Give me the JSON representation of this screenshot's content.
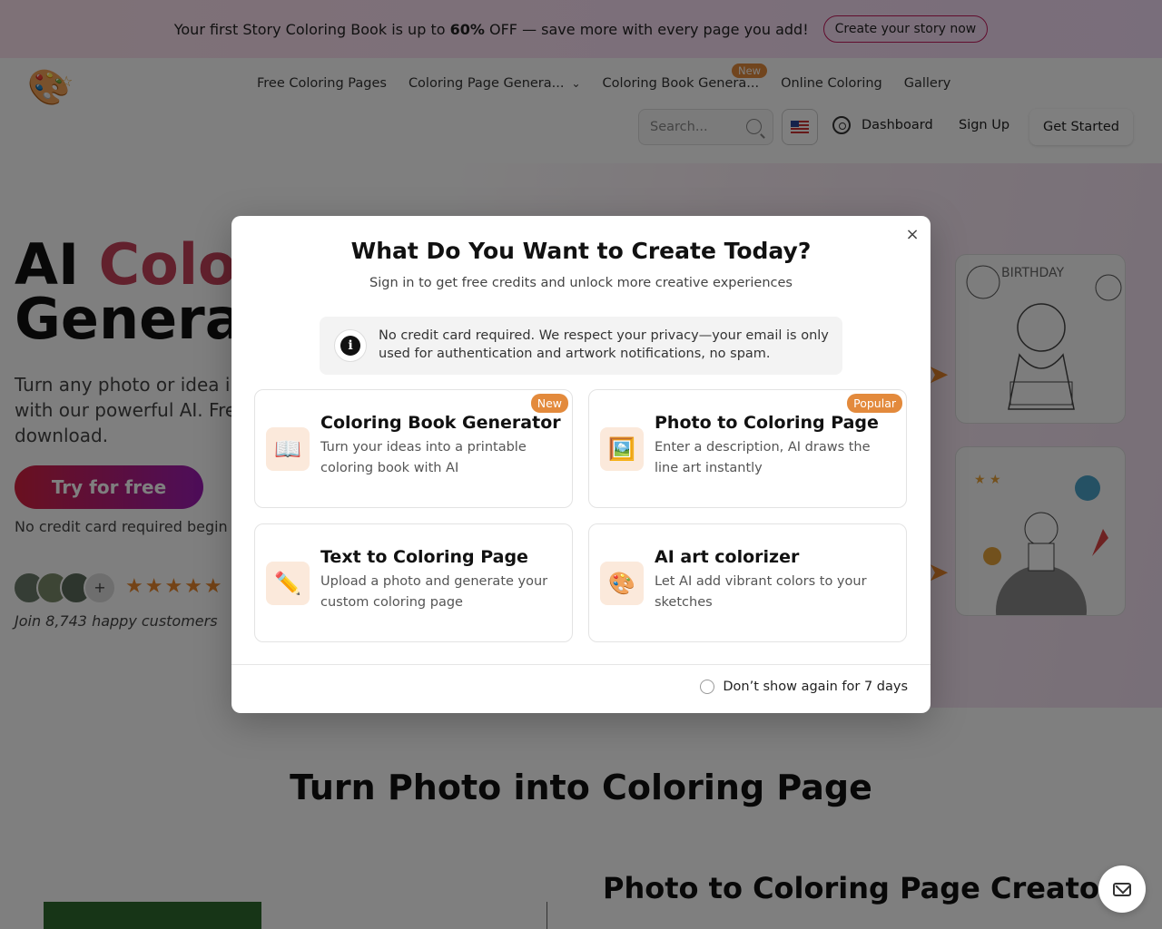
{
  "banner": {
    "text_before": "Your first Story Coloring Book is up to ",
    "text_bold": "60%",
    "text_after": " OFF — save more with every page you add!",
    "cta": "Create your story now"
  },
  "nav": {
    "links": [
      "Free Coloring Pages",
      "Coloring Page Genera...",
      "Coloring Book Genera...",
      "Online Coloring",
      "Gallery"
    ],
    "new_badge": "New",
    "search_placeholder": "Search...",
    "dashboard": "Dashboard",
    "sign_up": "Sign Up",
    "get_started": "Get Started"
  },
  "hero": {
    "title_line1_a": "AI ",
    "title_line1_b": "Colo",
    "title_line2": "Genera",
    "subtitle": "Turn any photo or idea i with our powerful AI. Fre download.",
    "try_button": "Try for free",
    "no_cc": "No credit card required begin",
    "avatar_plus": "+",
    "stars": "★★★★★",
    "join": "Join 8,743 happy customers"
  },
  "sections": {
    "title": "Turn Photo into Coloring Page",
    "creator_title": "Photo to Coloring Page Creator"
  },
  "modal": {
    "close": "×",
    "title": "What Do You Want to Create Today?",
    "subtitle": "Sign in to get free credits and unlock more creative experiences",
    "notice_icon": "i",
    "notice": "No credit card required. We respect your privacy—your email is only used for authentication and artwork notifications, no spam.",
    "cards": [
      {
        "icon": "📖",
        "title": "Coloring Book Generator",
        "desc": "Turn your ideas into a printable coloring book with AI",
        "badge": "New"
      },
      {
        "icon": "🖼️",
        "title": "Photo to Coloring Page",
        "desc": "Enter a description, AI draws the line art instantly",
        "badge": "Popular"
      },
      {
        "icon": "✏️",
        "title": "Text to Coloring Page",
        "desc": "Upload a photo and generate your custom coloring page",
        "badge": ""
      },
      {
        "icon": "🎨",
        "title": "AI art colorizer",
        "desc": "Let AI add vibrant colors to your sketches",
        "badge": ""
      }
    ],
    "dont_show": "Don’t show again for 7 days"
  },
  "colors": {
    "accent_orange": "#e38a3c",
    "accent_pink": "#c2185b",
    "hero_gradient_start": "#d4213f",
    "hero_gradient_end": "#9b1bb4"
  }
}
